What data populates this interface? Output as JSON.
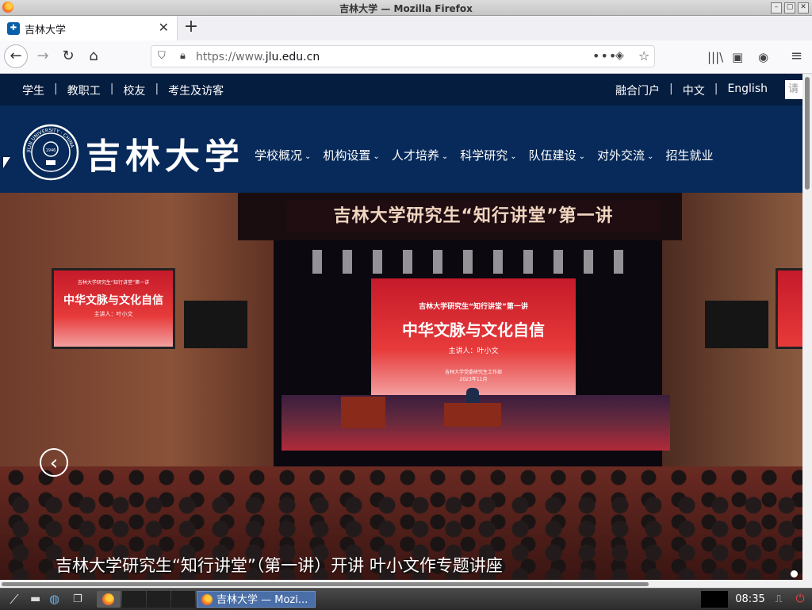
{
  "window": {
    "title": "吉林大学 — Mozilla Firefox",
    "buttons": [
      "–",
      "▢",
      "✕"
    ]
  },
  "tabs": [
    {
      "label": "吉林大学",
      "favicon": "university-favicon",
      "close": "✕"
    }
  ],
  "newtab": "+",
  "nav": {
    "url_prefix": "https://www.",
    "url_host": "jlu.edu.cn",
    "back_icon": "←",
    "forward_icon": "→",
    "reload_icon": "↻",
    "home_icon": "⌂",
    "more_icon": "•••",
    "pocket_icon": "◈",
    "star_icon": "☆",
    "library_icon": "|||\\",
    "sidebar_icon": "▣",
    "account_icon": "◉",
    "menu_icon": "≡"
  },
  "site": {
    "topbar_left": [
      "学生",
      "教职工",
      "校友",
      "考生及访客"
    ],
    "topbar_right": [
      "融合门户",
      "中文",
      "English"
    ],
    "separator": "|",
    "search_placeholder": "请",
    "logo_text": "吉林大学",
    "logo_ring": "JILIN UNIVERSITY · CHINA",
    "logo_year": "1946",
    "nav": [
      "学校概况",
      "机构设置",
      "人才培养",
      "科学研究",
      "队伍建设",
      "对外交流",
      "招生就业"
    ],
    "nav_caret": "⌄"
  },
  "hero": {
    "banner": "吉林大学研究生“知行讲堂”第一讲",
    "screen_line1": "吉林大学研究生“知行讲堂”第一讲",
    "screen_title": "中华文脉与文化自信",
    "screen_speaker": "主讲人：叶小文",
    "screen_org": "吉林大学党委研究生工作部",
    "screen_date": "2023年11月",
    "side_line1": "吉林大学研究生“知行讲堂”第一讲",
    "side_title": "中华文脉与文化自信",
    "side_speaker": "主讲人：叶小文",
    "prev_icon": "‹",
    "caption": "吉林大学研究生“知行讲堂”（第一讲）开讲 叶小文作专题讲座"
  },
  "taskbar": {
    "menu_icon": "⟋",
    "files_icon": "▬",
    "globe_icon": "◍",
    "windows_icon": "❐",
    "task_label": "吉林大学 — Mozi...",
    "clock": "08:35",
    "network_icon": "⎍",
    "power_icon": "⏻"
  }
}
